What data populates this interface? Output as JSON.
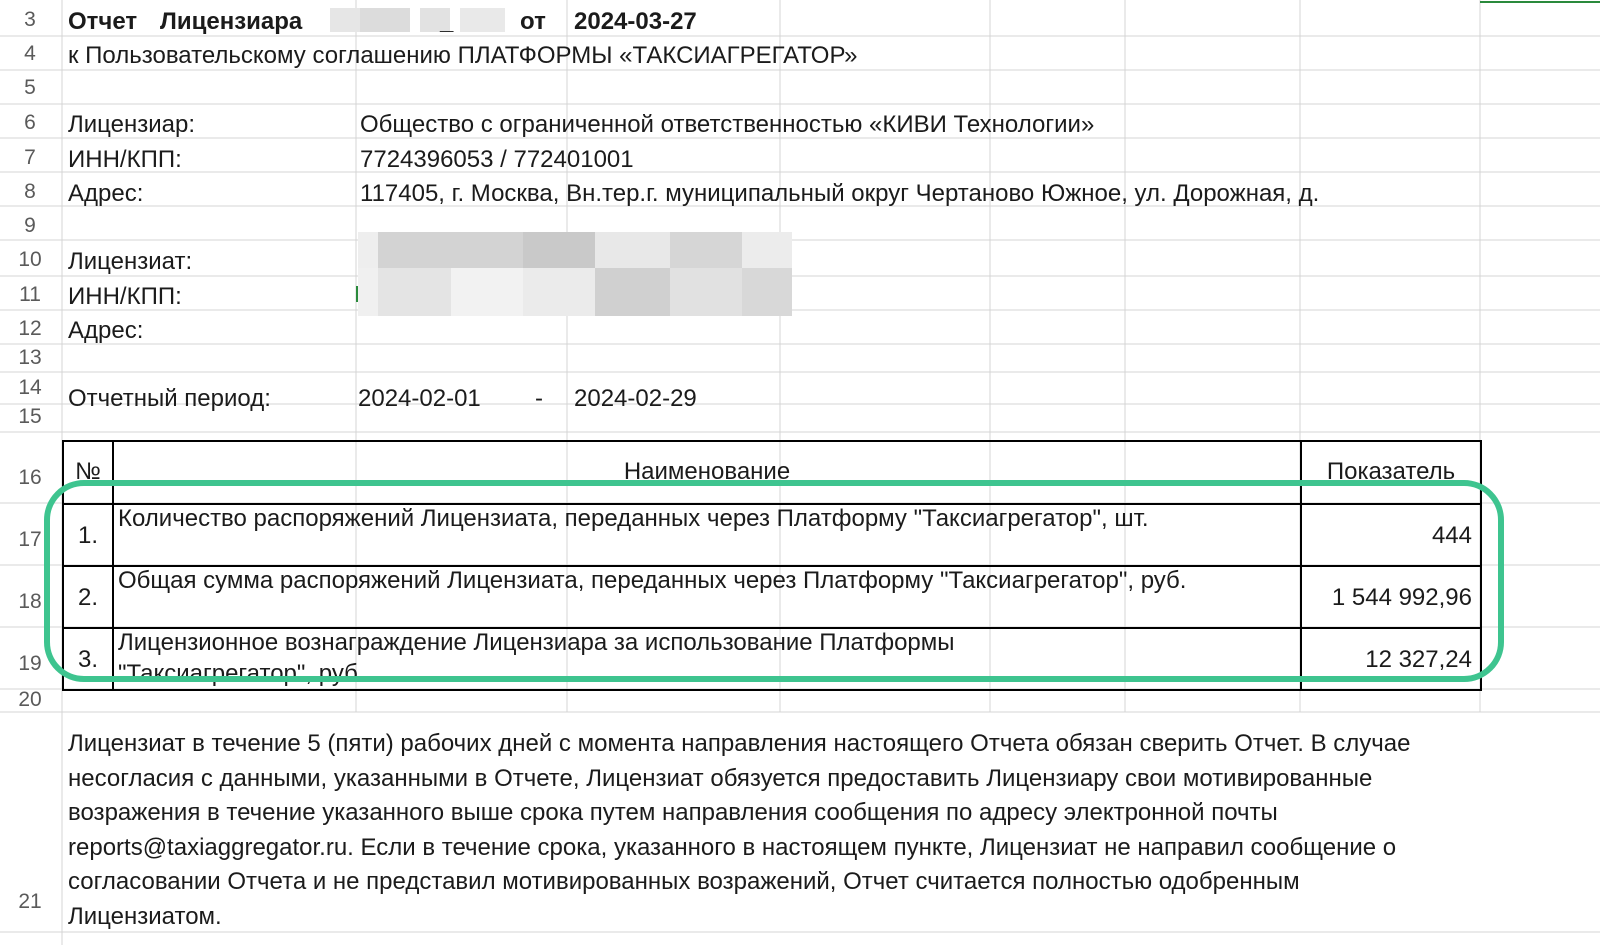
{
  "rows": {
    "labels": [
      "3",
      "4",
      "5",
      "6",
      "7",
      "8",
      "9",
      "10",
      "11",
      "12",
      "13",
      "14",
      "15",
      "16",
      "17",
      "18",
      "19",
      "20",
      "21"
    ]
  },
  "header": {
    "report_word": "Отчет",
    "licensor_word": "Лицензиара",
    "underscore": "_",
    "ot_word": "от",
    "date": "2024-03-27",
    "subtitle": "к Пользовательскому соглашению ПЛАТФОРМЫ «ТАКСИАГРЕГАТОР»"
  },
  "licensor": {
    "label": "Лицензиар:",
    "value": "Общество с ограниченной ответственностью «КИВИ Технологии»",
    "inn_label": "ИНН/КПП:",
    "inn_value": "7724396053 / 772401001",
    "address_label": "Адрес:",
    "address_value": "117405, г. Москва, Вн.тер.г. муниципальный округ Чертаново Южное, ул. Дорожная, д."
  },
  "licensee": {
    "label": "Лицензиат:",
    "inn_label": "ИНН/КПП:",
    "address_label": "Адрес:"
  },
  "period": {
    "label": "Отчетный период:",
    "start": "2024-02-01",
    "dash": "-",
    "end": "2024-02-29"
  },
  "table": {
    "col_num": "№",
    "col_name": "Наименование",
    "col_value": "Показатель",
    "rows": [
      {
        "num": "1.",
        "name": "Количество распоряжений Лицензиата, переданных через Платформу \"Таксиагрегатор\", шт.",
        "value": "444"
      },
      {
        "num": "2.",
        "name": "Общая сумма распоряжений Лицензиата, переданных через Платформу \"Таксиагрегатор\", руб.",
        "value": "1 544 992,96"
      },
      {
        "num": "3.",
        "name": "Лицензионное вознаграждение Лицензиара за использование Платформы \"Таксиагрегатор\", руб.",
        "value": "12 327,24"
      }
    ]
  },
  "footer_text": "Лицензиат в течение 5 (пяти) рабочих дней с момента направления настоящего Отчета обязан сверить Отчет. В случае несогласия с данными, указанными в Отчете, Лицензиат обязуется предоставить Лицензиару свои мотивированные возражения в течение указанного выше срока путем направления сообщения по адресу электронной почты reports@taxiaggregator.ru. Если в течение срока, указанного в настоящем пункте, Лицензиат не направил сообщение о согласовании Отчета и не представил мотивированных возражений, Отчет считается полностью одобренным Лицензиатом.",
  "colors": {
    "highlight": "#3ec48f",
    "gridline": "#d4d4d4",
    "blur": "#d9d9d9"
  }
}
